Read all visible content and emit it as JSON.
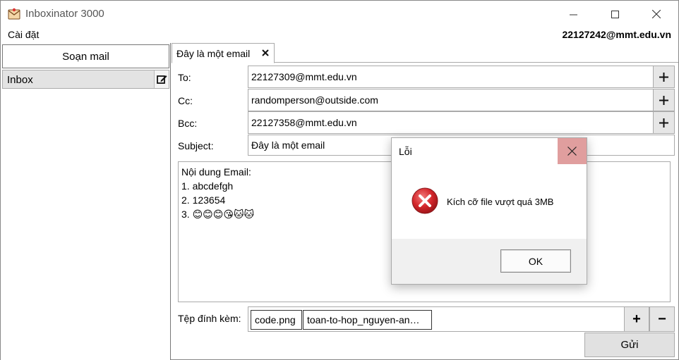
{
  "window": {
    "title": "Inboxinator 3000"
  },
  "menubar": {
    "settings_label": "Cài đặt",
    "user_email": "22127242@mmt.edu.vn"
  },
  "sidebar": {
    "compose_label": "Soạn mail",
    "inbox_label": "Inbox"
  },
  "tab": {
    "label": "Đây là một email"
  },
  "form": {
    "to_label": "To:",
    "to_value": "22127309@mmt.edu.vn",
    "cc_label": "Cc:",
    "cc_value": "randomperson@outside.com",
    "bcc_label": "Bcc:",
    "bcc_value": "22127358@mmt.edu.vn",
    "subject_label": "Subject:",
    "subject_value": "Đây là một email",
    "body_lines": [
      "Nội dung Email:",
      "1. abcdefgh",
      "2. 123654",
      "3. 😊😊😊😘🐱🐱"
    ],
    "attach_label": "Tệp đính kèm:",
    "attachments": [
      "code.png",
      "toan-to-hop_nguyen-an…"
    ],
    "add_symbol": "+",
    "remove_symbol": "−",
    "send_label": "Gửi"
  },
  "dialog": {
    "title": "Lỗi",
    "message": "Kích cỡ file vượt quá 3MB",
    "ok_label": "OK"
  },
  "colors": {
    "dialog_close_bg": "#e09e9e",
    "error_red": "#d3262b",
    "inbox_bg": "#e3e3e3"
  },
  "icons": {
    "app": "envelope-icon",
    "inbox_edit": "edit-icon",
    "error": "error-icon"
  }
}
